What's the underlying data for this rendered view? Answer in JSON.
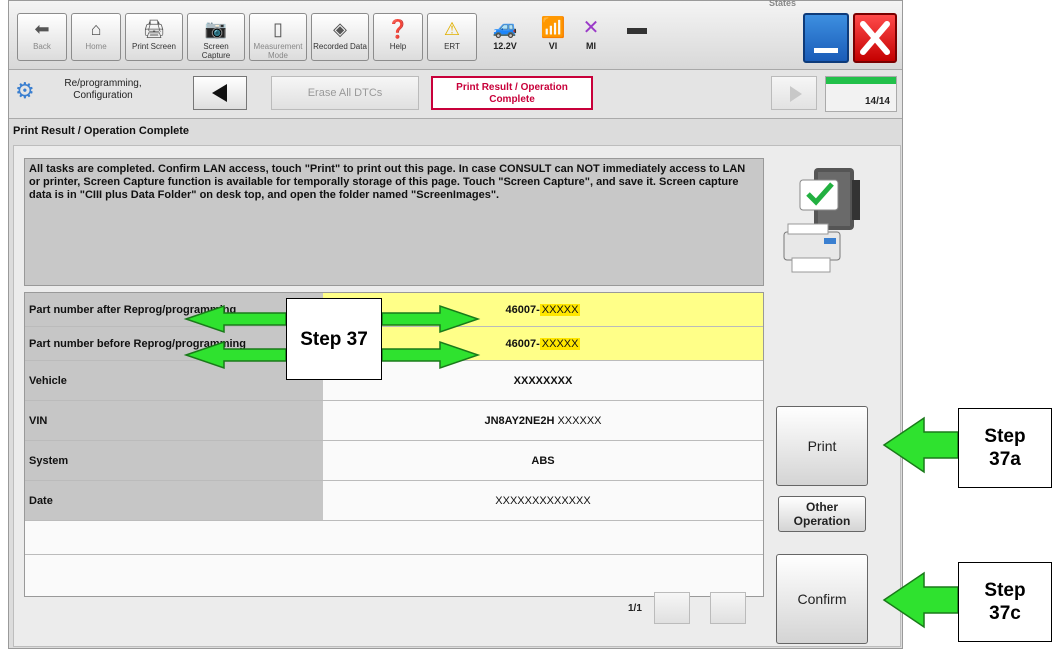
{
  "toolbar": {
    "states_label": "States",
    "back_label": "Back",
    "home_label": "Home",
    "print_screen_label": "Print Screen",
    "screen_capture_label": "Screen Capture",
    "measurement_mode_label": "Measurement Mode",
    "recorded_data_label": "Recorded Data",
    "help_label": "Help",
    "ert_label": "ERT",
    "voltage_label": "12.2V",
    "vi_label": "VI",
    "mi_label": "MI"
  },
  "breadcrumb": {
    "section_label": "Re/programming, Configuration",
    "erase_label": "Erase All DTCs",
    "current_label": "Print Result / Operation Complete",
    "progress_text": "14/14",
    "progress_fraction": 1.0
  },
  "page_title": "Print Result / Operation Complete",
  "message": "All tasks are completed. Confirm LAN access, touch \"Print\" to print out this page. In case CONSULT can NOT immediately access to LAN or printer, Screen Capture function is available for temporally storage of this page. Touch \"Screen Capture\", and save it. Screen capture data is in \"CIII plus Data Folder\" on desk top, and open the folder named \"ScreenImages\".",
  "table": {
    "after_label": "Part number after Reprog/programming",
    "after_prefix": "46007-",
    "after_value": "XXXXX",
    "before_label": "Part number before Reprog/programming",
    "before_prefix": "46007-",
    "before_value": "XXXXX",
    "vehicle_label": "Vehicle",
    "vehicle_value": "XXXXXXXX",
    "vin_label": "VIN",
    "vin_prefix": "JN8AY2NE2H",
    "vin_value": "XXXXXX",
    "system_label": "System",
    "system_value": "ABS",
    "date_label": "Date",
    "date_value": "XXXXXXXXXXXXX"
  },
  "buttons": {
    "print": "Print",
    "other_operation": "Other Operation",
    "confirm": "Confirm"
  },
  "pager": "1/1",
  "callouts": {
    "step37": "Step 37",
    "step37a": "Step 37a",
    "step37c": "Step 37c"
  },
  "colors": {
    "arrow_green": "#2fe22f",
    "highlight_yellow": "#ffff88",
    "active_step": "#c8003a"
  }
}
